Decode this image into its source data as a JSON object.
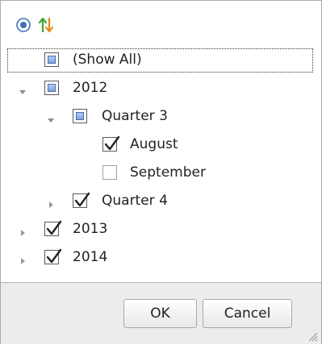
{
  "toolbar": {
    "radio_icon": "radio-selected-icon",
    "sort_icon": "sort-updown-icon"
  },
  "tree": [
    {
      "name": "show-all",
      "label": "(Show All)",
      "state": "indeterminate",
      "expander": "none"
    },
    {
      "name": "2012",
      "label": "2012",
      "state": "indeterminate",
      "expander": "expanded"
    },
    {
      "name": "2012-quarter-3",
      "label": "Quarter 3",
      "state": "indeterminate",
      "expander": "expanded"
    },
    {
      "name": "2012-quarter-3-august",
      "label": "August",
      "state": "checked",
      "expander": "none"
    },
    {
      "name": "2012-quarter-3-september",
      "label": "September",
      "state": "unchecked",
      "expander": "none"
    },
    {
      "name": "2012-quarter-4",
      "label": "Quarter 4",
      "state": "checked",
      "expander": "collapsed"
    },
    {
      "name": "2013",
      "label": "2013",
      "state": "checked",
      "expander": "collapsed"
    },
    {
      "name": "2014",
      "label": "2014",
      "state": "checked",
      "expander": "collapsed"
    }
  ],
  "footer": {
    "ok_label": "OK",
    "cancel_label": "Cancel"
  },
  "colors": {
    "accent": "#3f6fb8",
    "sort_green": "#3aa62e",
    "sort_orange": "#e08a1c"
  }
}
